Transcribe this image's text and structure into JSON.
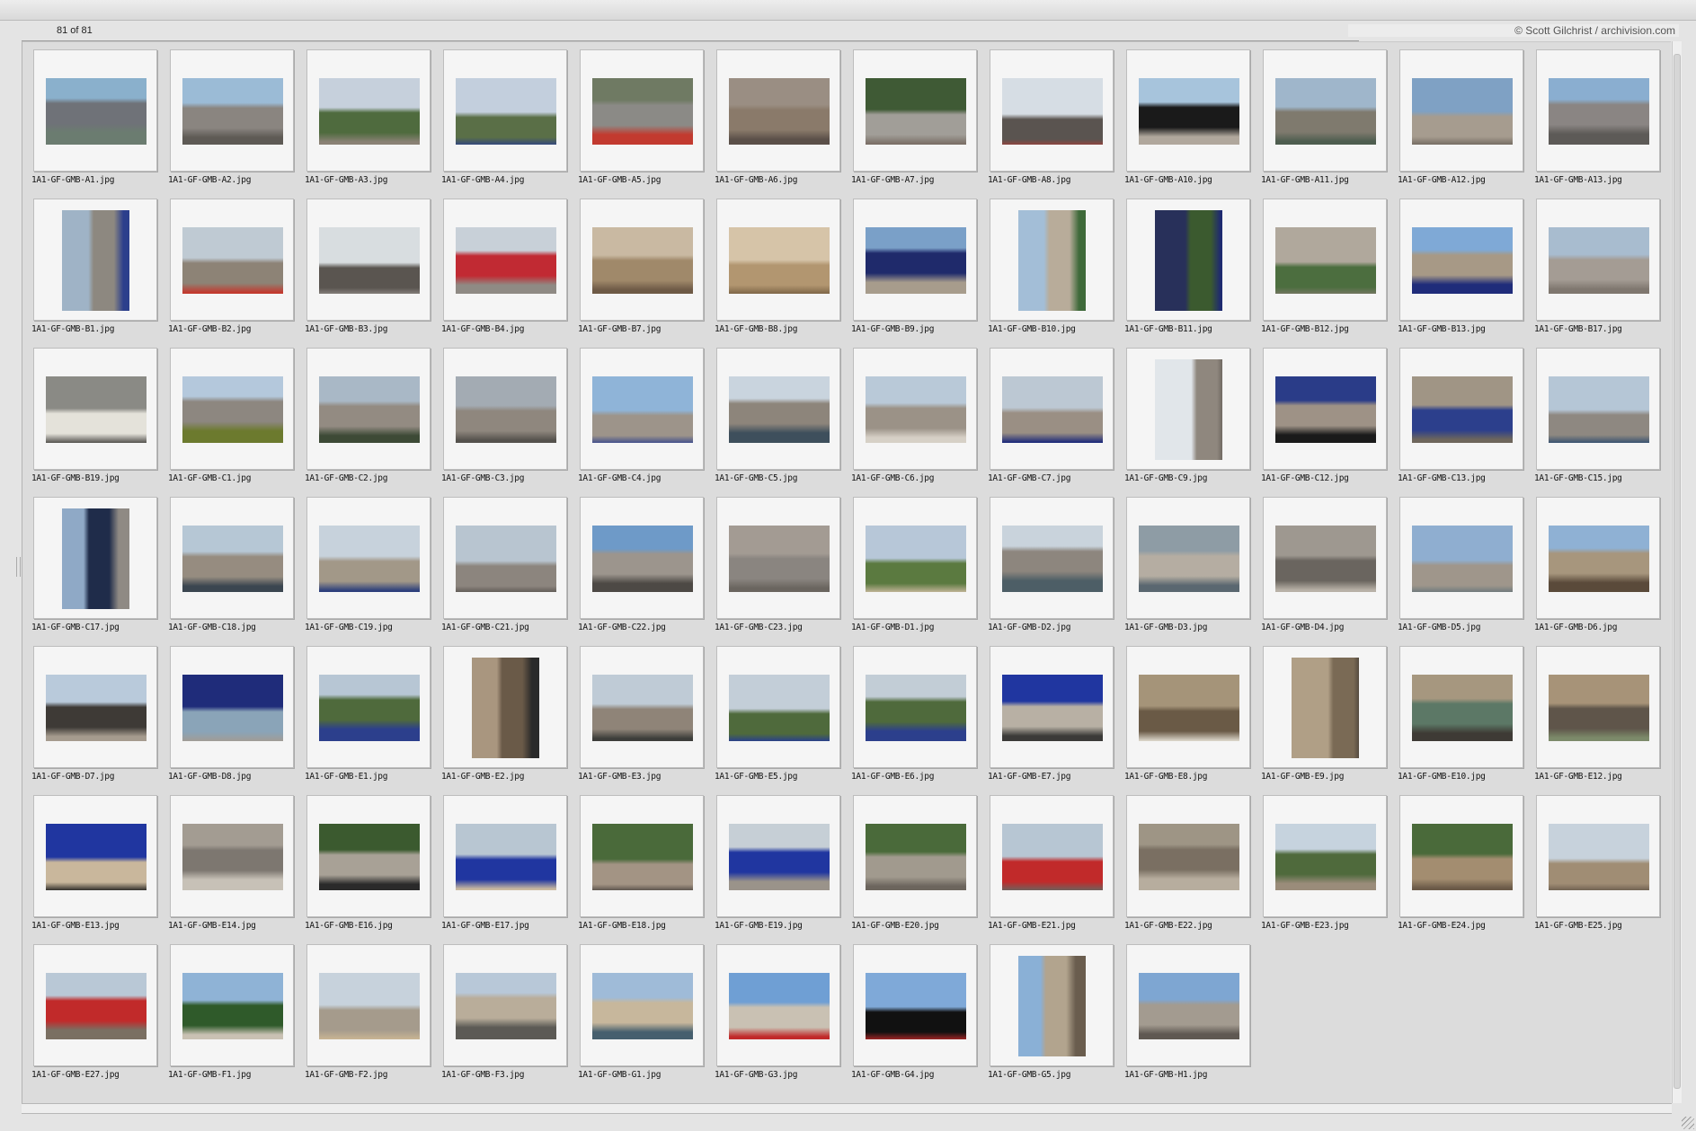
{
  "header": {
    "count": "81 of 81",
    "credit": "© Scott Gilchrist / archivision.com"
  },
  "thumb_icon": "photo-thumbnail",
  "images": [
    {
      "name": "1A1-GF-GMB-A1.jpg",
      "orientation": "landscape",
      "colors": [
        "#8ab0cc",
        "#6f7278",
        "#6b7c70"
      ]
    },
    {
      "name": "1A1-GF-GMB-A2.jpg",
      "orientation": "landscape",
      "colors": [
        "#9bbbd6",
        "#8a8580",
        "#5e5a55"
      ]
    },
    {
      "name": "1A1-GF-GMB-A3.jpg",
      "orientation": "landscape",
      "colors": [
        "#c6d0dc",
        "#4f6b3e",
        "#8a8175"
      ]
    },
    {
      "name": "1A1-GF-GMB-A4.jpg",
      "orientation": "landscape",
      "colors": [
        "#c3cfdd",
        "#5a6f47",
        "#2c3f8c"
      ]
    },
    {
      "name": "1A1-GF-GMB-A5.jpg",
      "orientation": "landscape",
      "colors": [
        "#6f7a63",
        "#8b8a86",
        "#c23a2f"
      ]
    },
    {
      "name": "1A1-GF-GMB-A6.jpg",
      "orientation": "landscape",
      "colors": [
        "#9a8e83",
        "#8a7a6a",
        "#5b5049"
      ]
    },
    {
      "name": "1A1-GF-GMB-A7.jpg",
      "orientation": "landscape",
      "colors": [
        "#3f5a35",
        "#a19e98",
        "#7a6f66"
      ]
    },
    {
      "name": "1A1-GF-GMB-A8.jpg",
      "orientation": "landscape",
      "colors": [
        "#d6dde4",
        "#5a5450",
        "#b33a33"
      ]
    },
    {
      "name": "1A1-GF-GMB-A10.jpg",
      "orientation": "landscape",
      "colors": [
        "#a7c4dc",
        "#1a1a1a",
        "#b0a79c"
      ]
    },
    {
      "name": "1A1-GF-GMB-A11.jpg",
      "orientation": "landscape",
      "colors": [
        "#9fb6cb",
        "#7f7a6e",
        "#4e5d4f"
      ]
    },
    {
      "name": "1A1-GF-GMB-A12.jpg",
      "orientation": "landscape",
      "colors": [
        "#7fa1c4",
        "#a69c8f",
        "#6e665d"
      ]
    },
    {
      "name": "1A1-GF-GMB-A13.jpg",
      "orientation": "landscape",
      "colors": [
        "#8aaed0",
        "#8a8583",
        "#5d5a57"
      ]
    },
    {
      "name": "1A1-GF-GMB-B1.jpg",
      "orientation": "portrait",
      "colors": [
        "#9fb3c6",
        "#8d8880",
        "#2c3f8c"
      ]
    },
    {
      "name": "1A1-GF-GMB-B2.jpg",
      "orientation": "landscape",
      "colors": [
        "#bfcad3",
        "#8d8376",
        "#c23a2f"
      ]
    },
    {
      "name": "1A1-GF-GMB-B3.jpg",
      "orientation": "landscape",
      "colors": [
        "#d8dde0",
        "#5a5550",
        "#9a9590"
      ]
    },
    {
      "name": "1A1-GF-GMB-B4.jpg",
      "orientation": "landscape",
      "colors": [
        "#c8d0d8",
        "#c12a33",
        "#8f8a84"
      ]
    },
    {
      "name": "1A1-GF-GMB-B7.jpg",
      "orientation": "landscape",
      "colors": [
        "#c9b9a2",
        "#a0896a",
        "#6e5a46"
      ]
    },
    {
      "name": "1A1-GF-GMB-B8.jpg",
      "orientation": "landscape",
      "colors": [
        "#d6c4a8",
        "#b29670",
        "#7b6345"
      ]
    },
    {
      "name": "1A1-GF-GMB-B9.jpg",
      "orientation": "landscape",
      "colors": [
        "#7aa0c8",
        "#1f2a6b",
        "#a79c8c"
      ]
    },
    {
      "name": "1A1-GF-GMB-B10.jpg",
      "orientation": "portrait",
      "colors": [
        "#a3bed7",
        "#b8ac9a",
        "#3f6a3a"
      ]
    },
    {
      "name": "1A1-GF-GMB-B11.jpg",
      "orientation": "portrait",
      "colors": [
        "#28305a",
        "#3b5a2f",
        "#1e2a70"
      ]
    },
    {
      "name": "1A1-GF-GMB-B12.jpg",
      "orientation": "landscape",
      "colors": [
        "#b0a89c",
        "#4c6e3f",
        "#80786d"
      ]
    },
    {
      "name": "1A1-GF-GMB-B13.jpg",
      "orientation": "landscape",
      "colors": [
        "#7fa9d6",
        "#a79986",
        "#1f2c7a"
      ]
    },
    {
      "name": "1A1-GF-GMB-B17.jpg",
      "orientation": "landscape",
      "colors": [
        "#a8bccf",
        "#a49c94",
        "#7f776f"
      ]
    },
    {
      "name": "1A1-GF-GMB-B19.jpg",
      "orientation": "landscape",
      "colors": [
        "#8a8a85",
        "#e4e2da",
        "#54524e"
      ]
    },
    {
      "name": "1A1-GF-GMB-C1.jpg",
      "orientation": "landscape",
      "colors": [
        "#b4c8dc",
        "#8d8780",
        "#6c7a2e"
      ]
    },
    {
      "name": "1A1-GF-GMB-C2.jpg",
      "orientation": "landscape",
      "colors": [
        "#a9b8c6",
        "#938b82",
        "#3d4a36"
      ]
    },
    {
      "name": "1A1-GF-GMB-C3.jpg",
      "orientation": "landscape",
      "colors": [
        "#a3abb3",
        "#8f877e",
        "#55524d"
      ]
    },
    {
      "name": "1A1-GF-GMB-C4.jpg",
      "orientation": "landscape",
      "colors": [
        "#8fb4d8",
        "#9d948a",
        "#2c3f8c"
      ]
    },
    {
      "name": "1A1-GF-GMB-C5.jpg",
      "orientation": "landscape",
      "colors": [
        "#c9d4de",
        "#8d857b",
        "#3e4f5c"
      ]
    },
    {
      "name": "1A1-GF-GMB-C6.jpg",
      "orientation": "landscape",
      "colors": [
        "#b9c9d8",
        "#9b9287",
        "#d6d0c6"
      ]
    },
    {
      "name": "1A1-GF-GMB-C7.jpg",
      "orientation": "landscape",
      "colors": [
        "#bcc8d3",
        "#9a8f84",
        "#1f2c7a"
      ]
    },
    {
      "name": "1A1-GF-GMB-C9.jpg",
      "orientation": "portrait",
      "colors": [
        "#e1e6ea",
        "#8f877e",
        "#5a544e"
      ]
    },
    {
      "name": "1A1-GF-GMB-C12.jpg",
      "orientation": "landscape",
      "colors": [
        "#2a3c88",
        "#9e9286",
        "#1a1a1a"
      ]
    },
    {
      "name": "1A1-GF-GMB-C13.jpg",
      "orientation": "landscape",
      "colors": [
        "#a09585",
        "#2c3f8c",
        "#6e665c"
      ]
    },
    {
      "name": "1A1-GF-GMB-C15.jpg",
      "orientation": "landscape",
      "colors": [
        "#b5c6d6",
        "#8e8881",
        "#2c4a6e"
      ]
    },
    {
      "name": "1A1-GF-GMB-C17.jpg",
      "orientation": "portrait",
      "colors": [
        "#8fa9c6",
        "#1f2c4a",
        "#8f8a84"
      ]
    },
    {
      "name": "1A1-GF-GMB-C18.jpg",
      "orientation": "landscape",
      "colors": [
        "#b6c7d5",
        "#968c80",
        "#3b4650"
      ]
    },
    {
      "name": "1A1-GF-GMB-C19.jpg",
      "orientation": "landscape",
      "colors": [
        "#c7d2dc",
        "#a29888",
        "#2c3f7c"
      ]
    },
    {
      "name": "1A1-GF-GMB-C21.jpg",
      "orientation": "landscape",
      "colors": [
        "#b8c5d0",
        "#8c857e",
        "#4c4844"
      ]
    },
    {
      "name": "1A1-GF-GMB-C22.jpg",
      "orientation": "landscape",
      "colors": [
        "#6e9ac8",
        "#9c958d",
        "#4d4945"
      ]
    },
    {
      "name": "1A1-GF-GMB-C23.jpg",
      "orientation": "landscape",
      "colors": [
        "#a39b93",
        "#8a8580",
        "#6a655f"
      ]
    },
    {
      "name": "1A1-GF-GMB-D1.jpg",
      "orientation": "landscape",
      "colors": [
        "#b7c7d8",
        "#5b7a40",
        "#c7b79c"
      ]
    },
    {
      "name": "1A1-GF-GMB-D2.jpg",
      "orientation": "landscape",
      "colors": [
        "#c9d3dc",
        "#8d867e",
        "#4d5e66"
      ]
    },
    {
      "name": "1A1-GF-GMB-D3.jpg",
      "orientation": "landscape",
      "colors": [
        "#8e9ca5",
        "#b5ada2",
        "#5a6770"
      ]
    },
    {
      "name": "1A1-GF-GMB-D4.jpg",
      "orientation": "landscape",
      "colors": [
        "#9e9890",
        "#6a655f",
        "#b8b1a7"
      ]
    },
    {
      "name": "1A1-GF-GMB-D5.jpg",
      "orientation": "landscape",
      "colors": [
        "#8faed0",
        "#9f968b",
        "#5e7078"
      ]
    },
    {
      "name": "1A1-GF-GMB-D6.jpg",
      "orientation": "landscape",
      "colors": [
        "#8fb1d4",
        "#a7967d",
        "#5a4a3a"
      ]
    },
    {
      "name": "1A1-GF-GMB-D7.jpg",
      "orientation": "landscape",
      "colors": [
        "#b9cadb",
        "#3e3a36",
        "#a59b8e"
      ]
    },
    {
      "name": "1A1-GF-GMB-D8.jpg",
      "orientation": "landscape",
      "colors": [
        "#1f2c7a",
        "#8aa4b8",
        "#a19c95"
      ]
    },
    {
      "name": "1A1-GF-GMB-E1.jpg",
      "orientation": "landscape",
      "colors": [
        "#b7c6d4",
        "#4f6a3c",
        "#2c3f8c"
      ]
    },
    {
      "name": "1A1-GF-GMB-E2.jpg",
      "orientation": "portrait",
      "colors": [
        "#a9967f",
        "#6a5a48",
        "#2a2a2a"
      ]
    },
    {
      "name": "1A1-GF-GMB-E3.jpg",
      "orientation": "landscape",
      "colors": [
        "#bfcbd6",
        "#8f8478",
        "#3d3d3a"
      ]
    },
    {
      "name": "1A1-GF-GMB-E5.jpg",
      "orientation": "landscape",
      "colors": [
        "#c3ced8",
        "#4f6a3c",
        "#2036a0"
      ]
    },
    {
      "name": "1A1-GF-GMB-E6.jpg",
      "orientation": "landscape",
      "colors": [
        "#c2cdd6",
        "#4f6a3c",
        "#2c3f8c"
      ]
    },
    {
      "name": "1A1-GF-GMB-E7.jpg",
      "orientation": "landscape",
      "colors": [
        "#2036a0",
        "#b8b0a4",
        "#3b3a38"
      ]
    },
    {
      "name": "1A1-GF-GMB-E8.jpg",
      "orientation": "landscape",
      "colors": [
        "#a59479",
        "#6a5a46",
        "#d8d2c6"
      ]
    },
    {
      "name": "1A1-GF-GMB-E9.jpg",
      "orientation": "portrait",
      "colors": [
        "#b09f86",
        "#7a6a55",
        "#3a3430"
      ]
    },
    {
      "name": "1A1-GF-GMB-E10.jpg",
      "orientation": "landscape",
      "colors": [
        "#a6977f",
        "#5c7866",
        "#3e3a35"
      ]
    },
    {
      "name": "1A1-GF-GMB-E12.jpg",
      "orientation": "landscape",
      "colors": [
        "#a79378",
        "#5f554a",
        "#7c8a6a"
      ]
    },
    {
      "name": "1A1-GF-GMB-E13.jpg",
      "orientation": "landscape",
      "colors": [
        "#2036a0",
        "#c9b79c",
        "#1a1a1a"
      ]
    },
    {
      "name": "1A1-GF-GMB-E14.jpg",
      "orientation": "landscape",
      "colors": [
        "#a39c92",
        "#7d7770",
        "#c7c1b7"
      ]
    },
    {
      "name": "1A1-GF-GMB-E16.jpg",
      "orientation": "landscape",
      "colors": [
        "#3b5a2f",
        "#a8a196",
        "#2a2a2a"
      ]
    },
    {
      "name": "1A1-GF-GMB-E17.jpg",
      "orientation": "landscape",
      "colors": [
        "#b8c6d2",
        "#2036a0",
        "#c9b9a0"
      ]
    },
    {
      "name": "1A1-GF-GMB-E18.jpg",
      "orientation": "landscape",
      "colors": [
        "#4a6a3a",
        "#a39484",
        "#3a3532"
      ]
    },
    {
      "name": "1A1-GF-GMB-E19.jpg",
      "orientation": "landscape",
      "colors": [
        "#c6cfd6",
        "#2036a0",
        "#9a938a"
      ]
    },
    {
      "name": "1A1-GF-GMB-E20.jpg",
      "orientation": "landscape",
      "colors": [
        "#4a6a3a",
        "#a19a8e",
        "#6c655d"
      ]
    },
    {
      "name": "1A1-GF-GMB-E21.jpg",
      "orientation": "landscape",
      "colors": [
        "#b7c6d3",
        "#c12a2a",
        "#6a6560"
      ]
    },
    {
      "name": "1A1-GF-GMB-E22.jpg",
      "orientation": "landscape",
      "colors": [
        "#9e9585",
        "#7a6f62",
        "#b7ad9e"
      ]
    },
    {
      "name": "1A1-GF-GMB-E23.jpg",
      "orientation": "landscape",
      "colors": [
        "#c6d3de",
        "#4f6a3c",
        "#9a8c7a"
      ]
    },
    {
      "name": "1A1-GF-GMB-E24.jpg",
      "orientation": "landscape",
      "colors": [
        "#4a6a3a",
        "#a38d70",
        "#6b5a48"
      ]
    },
    {
      "name": "1A1-GF-GMB-E25.jpg",
      "orientation": "landscape",
      "colors": [
        "#c7d2dc",
        "#a08d74",
        "#5f5246"
      ]
    },
    {
      "name": "1A1-GF-GMB-E27.jpg",
      "orientation": "landscape",
      "colors": [
        "#b9c8d6",
        "#c12a2a",
        "#7a6f62"
      ]
    },
    {
      "name": "1A1-GF-GMB-F1.jpg",
      "orientation": "landscape",
      "colors": [
        "#8fb3d6",
        "#2f5a2a",
        "#c9c1b3"
      ]
    },
    {
      "name": "1A1-GF-GMB-F2.jpg",
      "orientation": "landscape",
      "colors": [
        "#c7d2dc",
        "#a59b8c",
        "#c9b593"
      ]
    },
    {
      "name": "1A1-GF-GMB-F3.jpg",
      "orientation": "landscape",
      "colors": [
        "#b8c8d8",
        "#b9ad9a",
        "#5c5a55"
      ]
    },
    {
      "name": "1A1-GF-GMB-G1.jpg",
      "orientation": "landscape",
      "colors": [
        "#9fbbd8",
        "#c7b79c",
        "#465f6e"
      ]
    },
    {
      "name": "1A1-GF-GMB-G3.jpg",
      "orientation": "landscape",
      "colors": [
        "#6f9fd4",
        "#c9c1b3",
        "#c12a2a"
      ]
    },
    {
      "name": "1A1-GF-GMB-G4.jpg",
      "orientation": "landscape",
      "colors": [
        "#7fa9d8",
        "#111111",
        "#c12a2a"
      ]
    },
    {
      "name": "1A1-GF-GMB-G5.jpg",
      "orientation": "portrait",
      "colors": [
        "#8ab0d6",
        "#b2a48e",
        "#6a5d4e"
      ]
    },
    {
      "name": "1A1-GF-GMB-H1.jpg",
      "orientation": "landscape",
      "colors": [
        "#7ea6d2",
        "#a39b90",
        "#5f5852"
      ]
    }
  ]
}
